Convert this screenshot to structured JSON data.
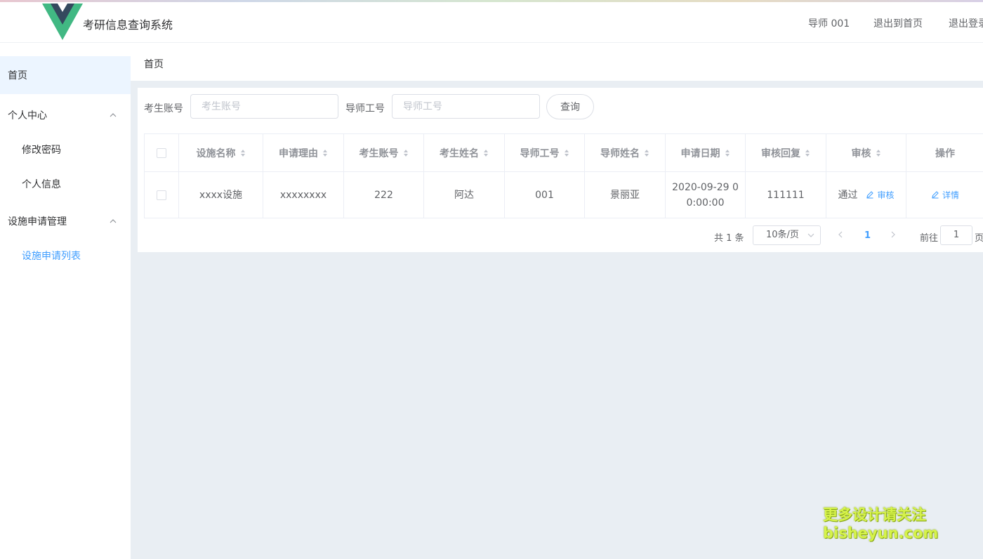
{
  "header": {
    "app_title": "考研信息查询系统",
    "user_label": "导师 001",
    "back_home": "退出到首页",
    "logout": "退出登录"
  },
  "colors": {
    "brand_green": "#41b883",
    "brand_dark": "#34495e",
    "accent": "#409eff"
  },
  "sidebar": {
    "items": [
      {
        "label": "首页",
        "active": true
      },
      {
        "label": "个人中心",
        "expandable": true
      },
      {
        "label": "修改密码",
        "sub": true
      },
      {
        "label": "个人信息",
        "sub": true
      },
      {
        "label": "设施申请管理",
        "expandable": true
      },
      {
        "label": "设施申请列表",
        "sub": true,
        "selected": true
      }
    ]
  },
  "breadcrumb": "首页",
  "search": {
    "student_label": "考生账号",
    "student_placeholder": "考生账号",
    "tutor_label": "导师工号",
    "tutor_placeholder": "导师工号",
    "query_button": "查询"
  },
  "table": {
    "columns": [
      "设施名称",
      "申请理由",
      "考生账号",
      "考生姓名",
      "导师工号",
      "导师姓名",
      "申请日期",
      "审核回复",
      "审核",
      "操作"
    ],
    "rows": [
      {
        "facility": "xxxx设施",
        "reason": "xxxxxxxx",
        "student_account": "222",
        "student_name": "阿达",
        "tutor_id": "001",
        "tutor_name": "景丽亚",
        "apply_date_line1": "2020-09-29 0",
        "apply_date_line2": "0:00:00",
        "reply": "111111",
        "status": "通过",
        "review_link": "审核",
        "detail_link": "详情"
      }
    ]
  },
  "pagination": {
    "total": "共 1 条",
    "page_size": "10条/页",
    "current_page": "1",
    "goto_label": "前往",
    "goto_value": "1",
    "page_suffix": "页"
  },
  "watermark": {
    "line1": "更多设计请关注",
    "line2": "bisheyun.com"
  }
}
